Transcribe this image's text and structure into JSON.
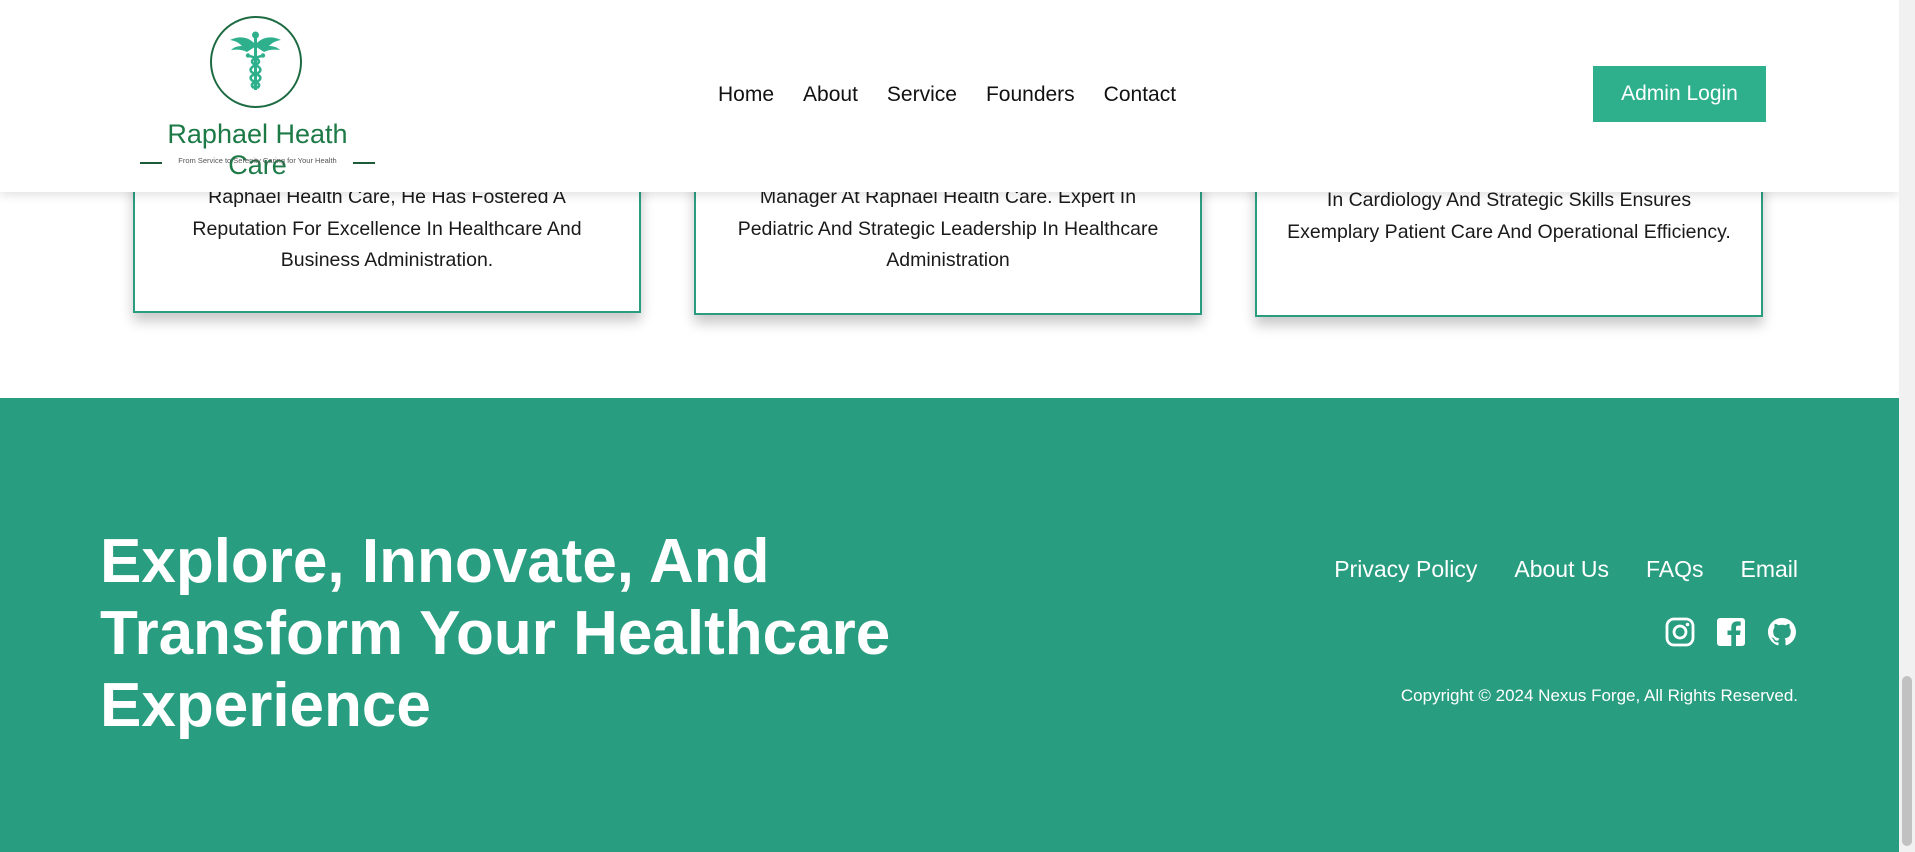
{
  "brand": {
    "name": "Raphael Heath Care",
    "tagline": "From Service to Serenity Caring for Your Health",
    "logo_icon": "caduceus-icon",
    "color_primary": "#2eb08d",
    "color_footer": "#289d80",
    "color_logo": "#1d7a47"
  },
  "nav": {
    "items": [
      {
        "label": "Home"
      },
      {
        "label": "About"
      },
      {
        "label": "Service"
      },
      {
        "label": "Founders"
      },
      {
        "label": "Contact"
      }
    ],
    "admin_label": "Admin Login"
  },
  "founders": {
    "cards": [
      {
        "text": "Raphael Health Care, He Has Fostered A Reputation For Excellence In Healthcare And Business Administration."
      },
      {
        "text": "Manager At Raphael Health Care. Expert In Pediatric And Strategic Leadership In Healthcare Administration"
      },
      {
        "text": "In Cardiology And Strategic Skills Ensures Exemplary Patient Care And Operational Efficiency."
      }
    ]
  },
  "footer": {
    "title": "Explore, Innovate, And Transform Your Healthcare Experience",
    "links": [
      {
        "label": "Privacy Policy"
      },
      {
        "label": "About Us"
      },
      {
        "label": "FAQs"
      },
      {
        "label": "Email"
      }
    ],
    "socials": [
      "instagram-icon",
      "facebook-icon",
      "github-icon"
    ],
    "copyright": "Copyright © 2024 Nexus Forge, All Rights Reserved."
  }
}
